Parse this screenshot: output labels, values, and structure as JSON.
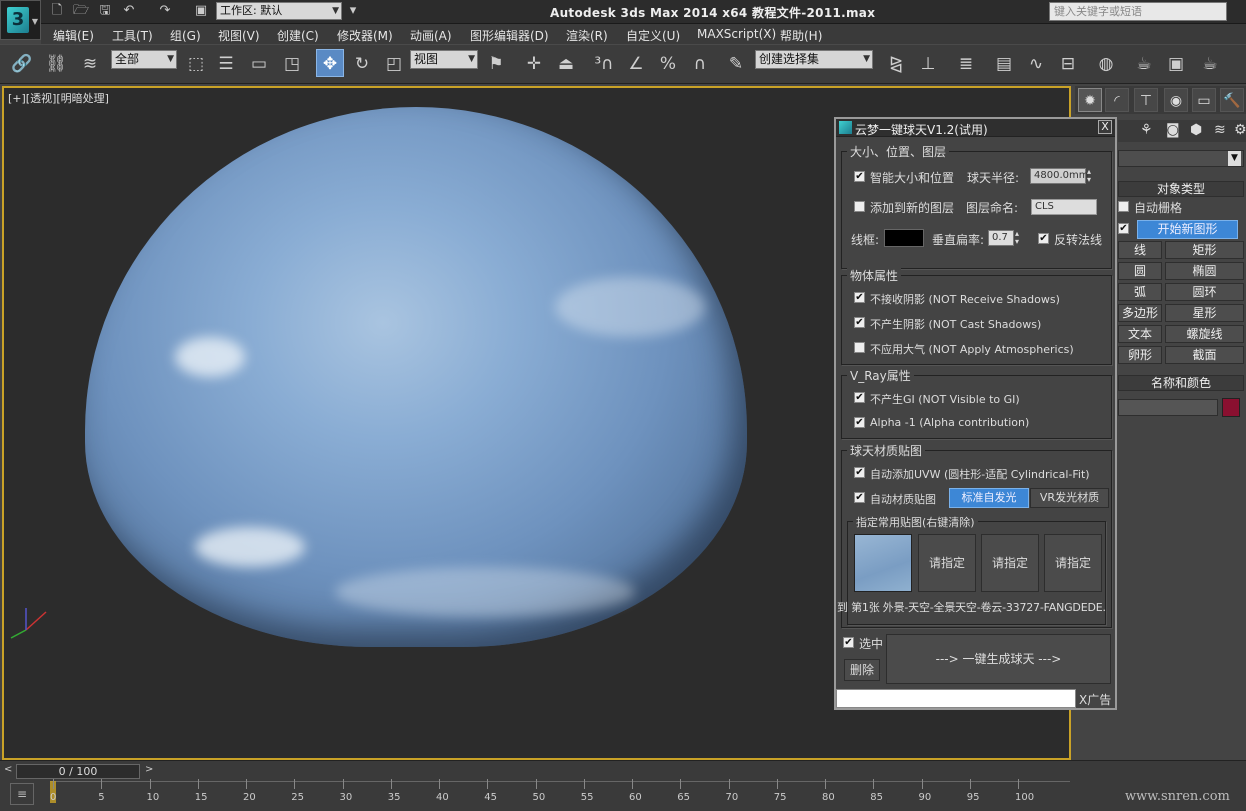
{
  "titlebar": {
    "workspace_label": "工作区: 默认",
    "app_title": "Autodesk 3ds Max  2014 x64    教程文件-2011.max",
    "search_placeholder": "键入关键字或短语"
  },
  "menu": [
    "编辑(E)",
    "工具(T)",
    "组(G)",
    "视图(V)",
    "创建(C)",
    "修改器(M)",
    "动画(A)",
    "图形编辑器(D)",
    "渲染(R)",
    "自定义(U)",
    "MAXScript(X)",
    "帮助(H)"
  ],
  "toolbar": {
    "filter": "全部",
    "ref_coord": "视图",
    "selection_set": "创建选择集"
  },
  "viewport": {
    "label": "[+][透视][明暗处理]"
  },
  "command_panel": {
    "object_type_header": "对象类型",
    "autogrid": "自动栅格",
    "start_new_shape": "开始新图形",
    "shape_buttons": [
      "线",
      "矩形",
      "圆",
      "椭圆",
      "弧",
      "圆环",
      "多边形",
      "星形",
      "文本",
      "螺旋线",
      "卵形",
      "截面"
    ],
    "name_color_header": "名称和颜色",
    "brand_color": "#8a1030"
  },
  "dialog": {
    "title": "云梦一键球天V1.2(试用)",
    "close": "X",
    "size_group": {
      "label": "大小、位置、图层",
      "smart_size": "智能大小和位置",
      "radius_label": "球天半径:",
      "radius_value": "4800.0mm",
      "add_layer": "添加到新的图层",
      "layer_label": "图层命名:",
      "layer_value": "CLS",
      "wire_label": "线框:",
      "flatten_label": "垂直扁率:",
      "flatten_value": "0.7",
      "flip_normals": "反转法线"
    },
    "object_group": {
      "label": "物体属性",
      "items": [
        "不接收阴影 (NOT Receive Shadows)",
        "不产生阴影 (NOT Cast Shadows)",
        "不应用大气 (NOT Apply Atmospherics)"
      ]
    },
    "vray_group": {
      "label": "V_Ray属性",
      "items": [
        "不产生GI (NOT Visible to GI)",
        "Alpha -1 (Alpha contribution)"
      ]
    },
    "material_group": {
      "label": "球天材质贴图",
      "auto_uvw": "自动添加UVW (圆柱形-适配 Cylindrical-Fit)",
      "auto_material": "自动材质贴图",
      "mat_btn1": "标准自发光",
      "mat_btn2": "VR发光材质",
      "common_maps_label": "指定常用贴图(右键清除)",
      "slot_labels": [
        "请指定",
        "请指定",
        "请指定"
      ],
      "caption": "到 第1张 外景-天空-全景天空-卷云-33727-FANGDEDE."
    },
    "selected_label": "选中",
    "delete_btn": "删除",
    "generate_btn": "---> 一键生成球天 --->",
    "ad_label": "X广告"
  },
  "timeline": {
    "frame_display": "0 / 100",
    "ticks": [
      "0",
      "5",
      "10",
      "15",
      "20",
      "25",
      "30",
      "35",
      "40",
      "45",
      "50",
      "55",
      "60",
      "65",
      "70",
      "75",
      "80",
      "85",
      "90",
      "95",
      "100"
    ]
  },
  "watermark": "www.snren.com"
}
